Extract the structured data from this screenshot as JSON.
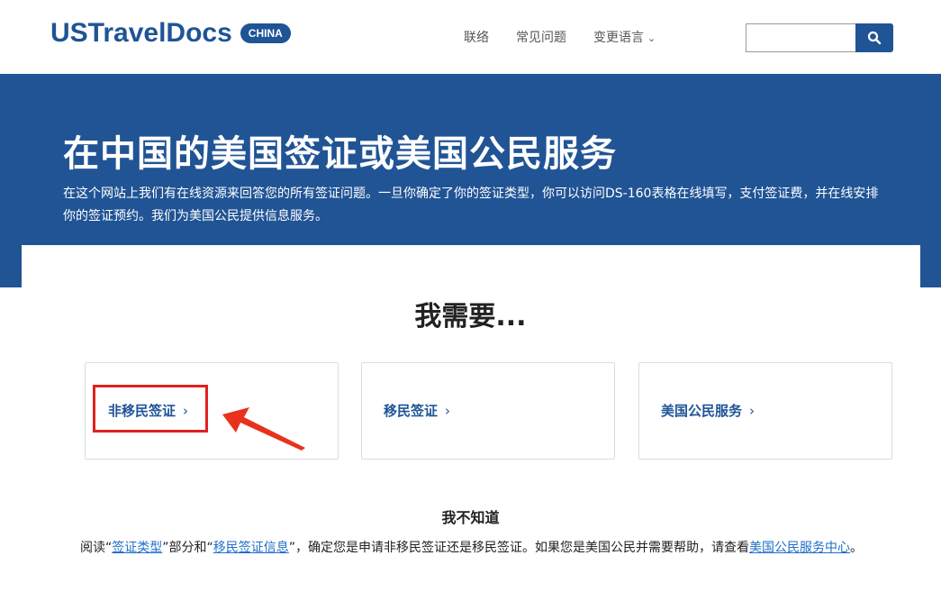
{
  "header": {
    "logo_text": "USTravelDocs",
    "logo_badge": "CHINA",
    "nav": {
      "contact": "联络",
      "faq": "常见问题",
      "language": "变更语言"
    },
    "search": {
      "placeholder": ""
    }
  },
  "hero": {
    "title": "在中国的美国签证或美国公民服务",
    "description": "在这个网站上我们有在线资源来回答您的所有签证问题。一旦你确定了你的签证类型，你可以访问DS-160表格在线填写，支付签证费，并在线安排你的签证预约。我们为美国公民提供信息服务。"
  },
  "main": {
    "heading": "我需要...",
    "options": [
      {
        "label": "非移民签证"
      },
      {
        "label": "移民签证"
      },
      {
        "label": "美国公民服务"
      }
    ],
    "dont_know": {
      "heading": "我不知道",
      "text_1": "阅读“",
      "link_1": "签证类型",
      "text_2": "”部分和“",
      "link_2": "移民签证信息",
      "text_3": "”，确定您是申请非移民签证还是移民签证。如果您是美国公民并需要帮助，请查看",
      "link_3": "美国公民服务中心",
      "text_4": "。"
    }
  },
  "colors": {
    "brand": "#1f5496",
    "hero_bg": "#215495",
    "highlight": "#e02020",
    "link": "#1f6fc9"
  },
  "icons": {
    "search": "search-icon",
    "chevron": "chevron-down-icon",
    "option_arrow": "chevron-right-icon",
    "pointer": "red-arrow-annotation"
  }
}
